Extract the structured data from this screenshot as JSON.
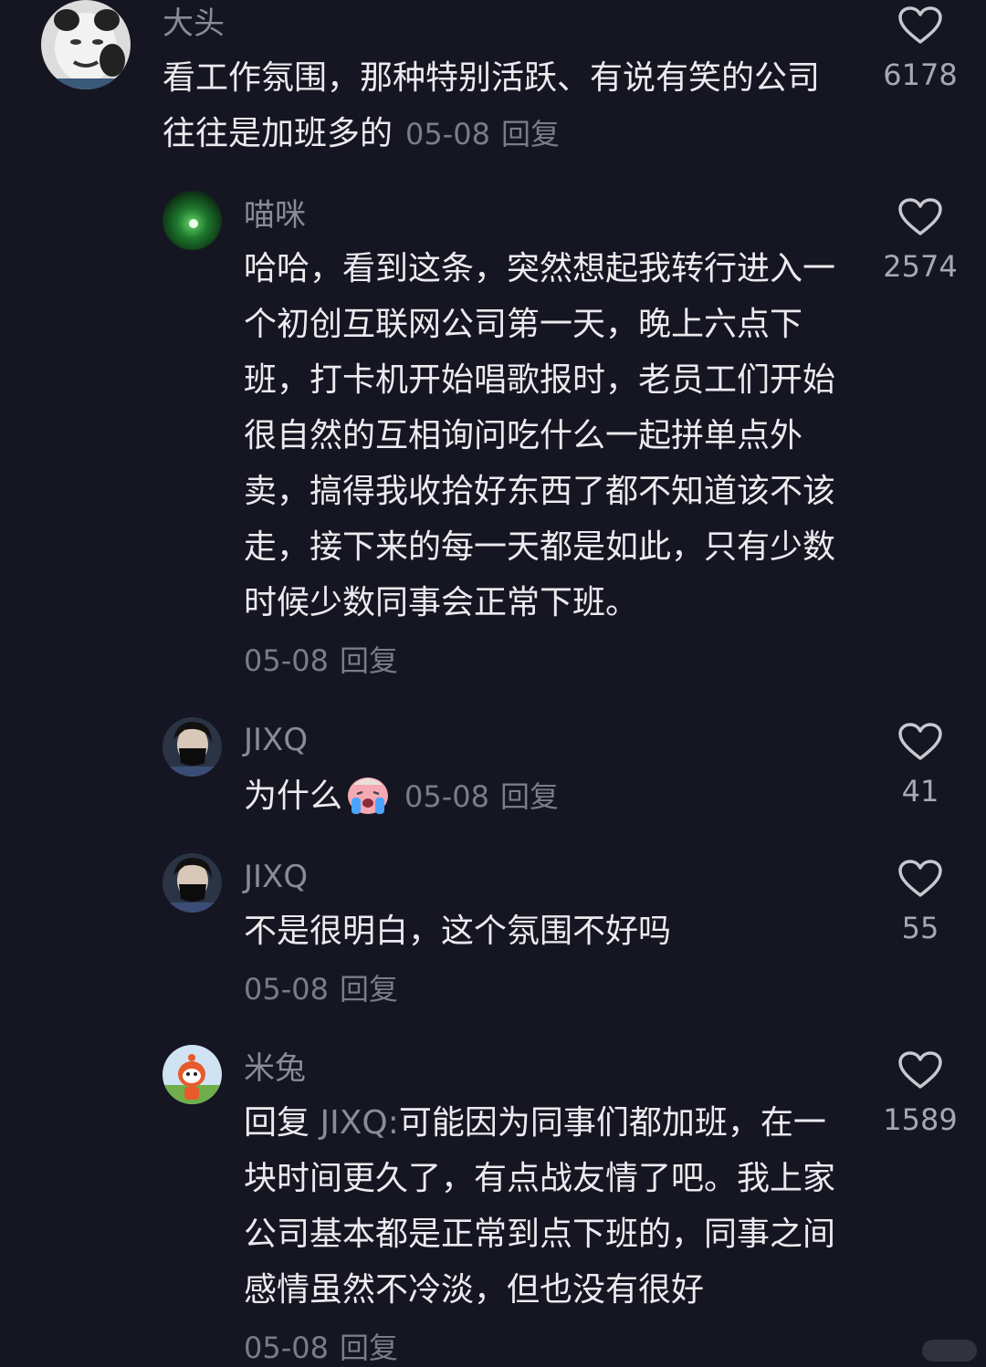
{
  "comments": [
    {
      "username": "大头",
      "text": "看工作氛围，那种特别活跃、有说有笑的公司往往是加班多的",
      "date": "05-08",
      "reply_label": "回复",
      "likes": "6178",
      "avatar_icon": "meme-face-avatar"
    },
    {
      "username": "喵咪",
      "text": "哈哈，看到这条，突然想起我转行进入一个初创互联网公司第一天，晚上六点下班，打卡机开始唱歌报时，老员工们开始很自然的互相询问吃什么一起拼单点外卖，搞得我收拾好东西了都不知道该不该走，接下来的每一天都是如此，只有少数时候少数同事会正常下班。",
      "date": "05-08",
      "reply_label": "回复",
      "likes": "2574",
      "avatar_icon": "green-orb-avatar"
    },
    {
      "username": "JIXQ",
      "text": "为什么",
      "emoji": "crying-emoji",
      "date": "05-08",
      "reply_label": "回复",
      "likes": "41",
      "avatar_icon": "masked-person-avatar"
    },
    {
      "username": "JIXQ",
      "text": "不是很明白，这个氛围不好吗",
      "date": "05-08",
      "reply_label": "回复",
      "likes": "55",
      "avatar_icon": "masked-person-avatar"
    },
    {
      "username": "米兔",
      "reply_prefix": "回复",
      "mention": "JIXQ:",
      "text": "可能因为同事们都加班，在一块时间更久了，有点战友情了吧。我上家公司基本都是正常到点下班的，同事之间感情虽然不冷淡，但也没有很好",
      "date": "05-08",
      "reply_label": "回复",
      "likes": "1589",
      "avatar_icon": "mitu-rabbit-avatar"
    }
  ],
  "colors": {
    "background": "#161622",
    "primary_text": "#ebebef",
    "secondary_text": "#8b8b94",
    "like_icon": "#c8c8cf"
  }
}
